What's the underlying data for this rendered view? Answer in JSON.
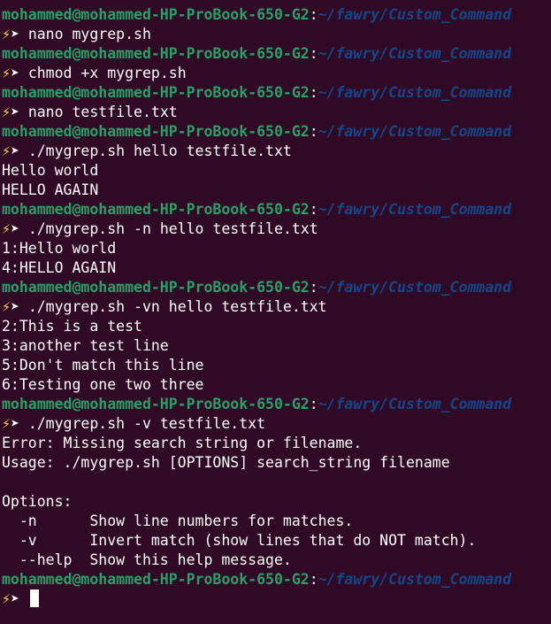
{
  "prompt": {
    "user_host": "mohammed@mohammed-HP-ProBook-650-G2",
    "separator": ":",
    "path": "~/fawry/Custom_Command",
    "bolt": "⚡",
    "arrow": "➤ "
  },
  "commands": {
    "c1": "nano mygrep.sh",
    "c2": "chmod +x mygrep.sh",
    "c3": "nano testfile.txt",
    "c4": "./mygrep.sh hello testfile.txt",
    "c5": "./mygrep.sh -n hello testfile.txt",
    "c6": "./mygrep.sh -vn hello testfile.txt",
    "c7": "./mygrep.sh -v testfile.txt"
  },
  "outputs": {
    "o4": [
      "Hello world",
      "HELLO AGAIN"
    ],
    "o5": [
      "1:Hello world",
      "4:HELLO AGAIN"
    ],
    "o6": [
      "2:This is a test",
      "3:another test line",
      "5:Don't match this line",
      "6:Testing one two three"
    ],
    "o7": [
      "Error: Missing search string or filename.",
      "Usage: ./mygrep.sh [OPTIONS] search_string filename",
      "",
      "Options:",
      "  -n      Show line numbers for matches.",
      "  -v      Invert match (show lines that do NOT match).",
      "  --help  Show this help message."
    ]
  },
  "colors": {
    "background": "#300a24",
    "user_host": "#26a269",
    "path": "#12488b",
    "bolt": "#f6d32d",
    "text": "#ffffff"
  }
}
